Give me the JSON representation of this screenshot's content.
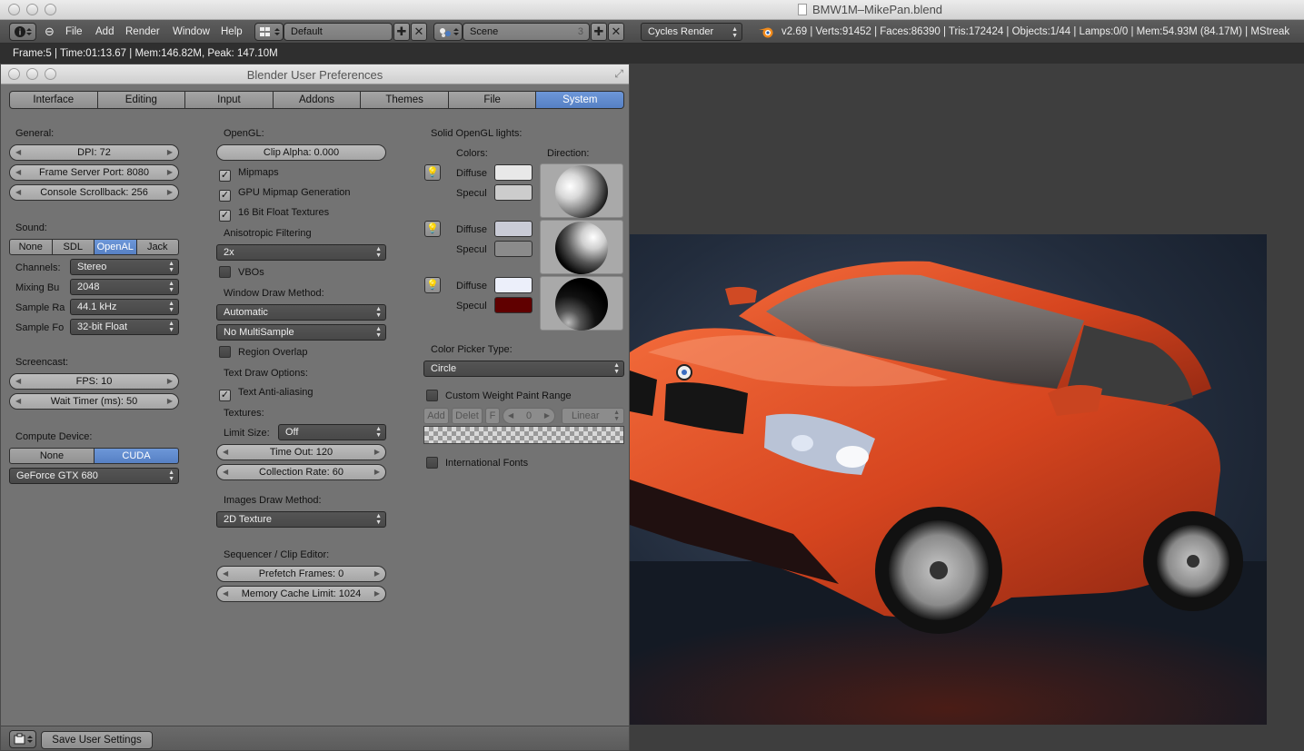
{
  "window": {
    "title": "BMW1M–MikePan.blend"
  },
  "header": {
    "menus": [
      "File",
      "Add",
      "Render",
      "Window",
      "Help"
    ],
    "screen_layout": "Default",
    "scene": "Scene",
    "scene_users": "3",
    "render_engine": "Cycles Render",
    "stats": "v2.69 | Verts:91452 | Faces:86390 | Tris:172424 | Objects:1/44 | Lamps:0/0 | Mem:54.93M (84.17M) | MStreak"
  },
  "info_bar": "Frame:5 | Time:01:13.67 | Mem:146.82M, Peak: 147.10M",
  "prefs": {
    "title": "Blender User Preferences",
    "tabs": [
      "Interface",
      "Editing",
      "Input",
      "Addons",
      "Themes",
      "File",
      "System"
    ],
    "active_tab": "System",
    "general": {
      "label": "General:",
      "dpi": "DPI: 72",
      "frame_server_port": "Frame Server Port: 8080",
      "console_scrollback": "Console Scrollback: 256"
    },
    "sound": {
      "label": "Sound:",
      "options": [
        "None",
        "SDL",
        "OpenAL",
        "Jack"
      ],
      "active": "OpenAL",
      "channels_label": "Channels:",
      "channels": "Stereo",
      "mixing_label": "Mixing Bu",
      "mixing": "2048",
      "sample_rate_label": "Sample Ra",
      "sample_rate": "44.1 kHz",
      "sample_format_label": "Sample Fo",
      "sample_format": "32-bit Float"
    },
    "screencast": {
      "label": "Screencast:",
      "fps": "FPS: 10",
      "wait_timer": "Wait Timer (ms): 50"
    },
    "compute": {
      "label": "Compute Device:",
      "options": [
        "None",
        "CUDA"
      ],
      "active": "CUDA",
      "device": "GeForce GTX 680"
    },
    "opengl": {
      "label": "OpenGL:",
      "clip_alpha": "Clip Alpha: 0.000",
      "mipmaps": "Mipmaps",
      "gpu_mipmap": "GPU Mipmap Generation",
      "float_textures": "16 Bit Float Textures",
      "aniso_label": "Anisotropic Filtering",
      "aniso": "2x",
      "vbos": "VBOs",
      "window_draw_label": "Window Draw Method:",
      "window_draw": "Automatic",
      "multisample": "No MultiSample",
      "region_overlap": "Region Overlap",
      "text_draw_label": "Text Draw Options:",
      "text_aa": "Text Anti-aliasing",
      "textures_label": "Textures:",
      "limit_size_label": "Limit Size:",
      "limit_size": "Off",
      "time_out": "Time Out: 120",
      "collection_rate": "Collection Rate: 60",
      "images_draw_label": "Images Draw Method:",
      "images_draw": "2D Texture",
      "sequencer_label": "Sequencer / Clip Editor:",
      "prefetch": "Prefetch Frames: 0",
      "memory_cache": "Memory Cache Limit: 1024"
    },
    "lights": {
      "label": "Solid OpenGL lights:",
      "colors_label": "Colors:",
      "direction_label": "Direction:",
      "diffuse_label": "Diffuse",
      "specular_label": "Specul",
      "items": [
        {
          "diffuse": "#e8e8e8",
          "specular": "#cccccc"
        },
        {
          "diffuse": "#c9cbd6",
          "specular": "#8b8b8b"
        },
        {
          "diffuse": "#eceffa",
          "specular": "#600000"
        }
      ],
      "color_picker_label": "Color Picker Type:",
      "color_picker": "Circle",
      "custom_weight": "Custom Weight Paint Range",
      "weight_add": "Add",
      "weight_delete": "Delet",
      "weight_f": "F",
      "weight_value": "0",
      "weight_interp": "Linear",
      "intl_fonts": "International Fonts"
    },
    "save_button": "Save User Settings"
  },
  "colors": {
    "accent": "#5a84c8",
    "panel": "#737373"
  }
}
